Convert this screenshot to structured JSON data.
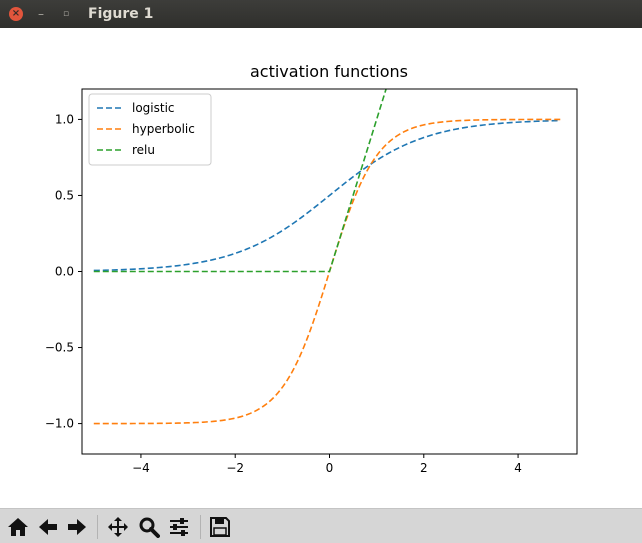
{
  "window": {
    "title": "Figure 1",
    "close_glyph": "×",
    "min_glyph": "–",
    "max_glyph": "▫"
  },
  "toolbar": {
    "items": [
      {
        "name": "home-button",
        "icon": "home-icon"
      },
      {
        "name": "back-button",
        "icon": "arrow-left-icon"
      },
      {
        "name": "forward-button",
        "icon": "arrow-right-icon"
      },
      {
        "name": "pan-button",
        "icon": "move-icon"
      },
      {
        "name": "zoom-button",
        "icon": "zoom-icon"
      },
      {
        "name": "configure-subplots-button",
        "icon": "sliders-icon"
      },
      {
        "name": "save-button",
        "icon": "save-icon"
      }
    ]
  },
  "chart_data": {
    "type": "line",
    "title": "activation functions",
    "xlabel": "",
    "ylabel": "",
    "xlim": [
      -5.25,
      5.25
    ],
    "ylim": [
      -1.2,
      1.2
    ],
    "xticks": [
      -4,
      -2,
      0,
      2,
      4
    ],
    "xtick_labels": [
      "−4",
      "−2",
      "0",
      "2",
      "4"
    ],
    "yticks": [
      -1.0,
      -0.5,
      0.0,
      0.5,
      1.0
    ],
    "ytick_labels": [
      "−1.0",
      "−0.5",
      "0.0",
      "0.5",
      "1.0"
    ],
    "grid": false,
    "legend_position": "top-left",
    "x_range": [
      -5,
      4.9
    ],
    "series": [
      {
        "name": "logistic",
        "function": "logistic",
        "color": "#1f77b4",
        "style": "dashed"
      },
      {
        "name": "hyperbolic",
        "function": "tanh",
        "color": "#ff7f0e",
        "style": "dashed"
      },
      {
        "name": "relu",
        "function": "relu",
        "color": "#2ca02c",
        "style": "dashed"
      }
    ]
  }
}
